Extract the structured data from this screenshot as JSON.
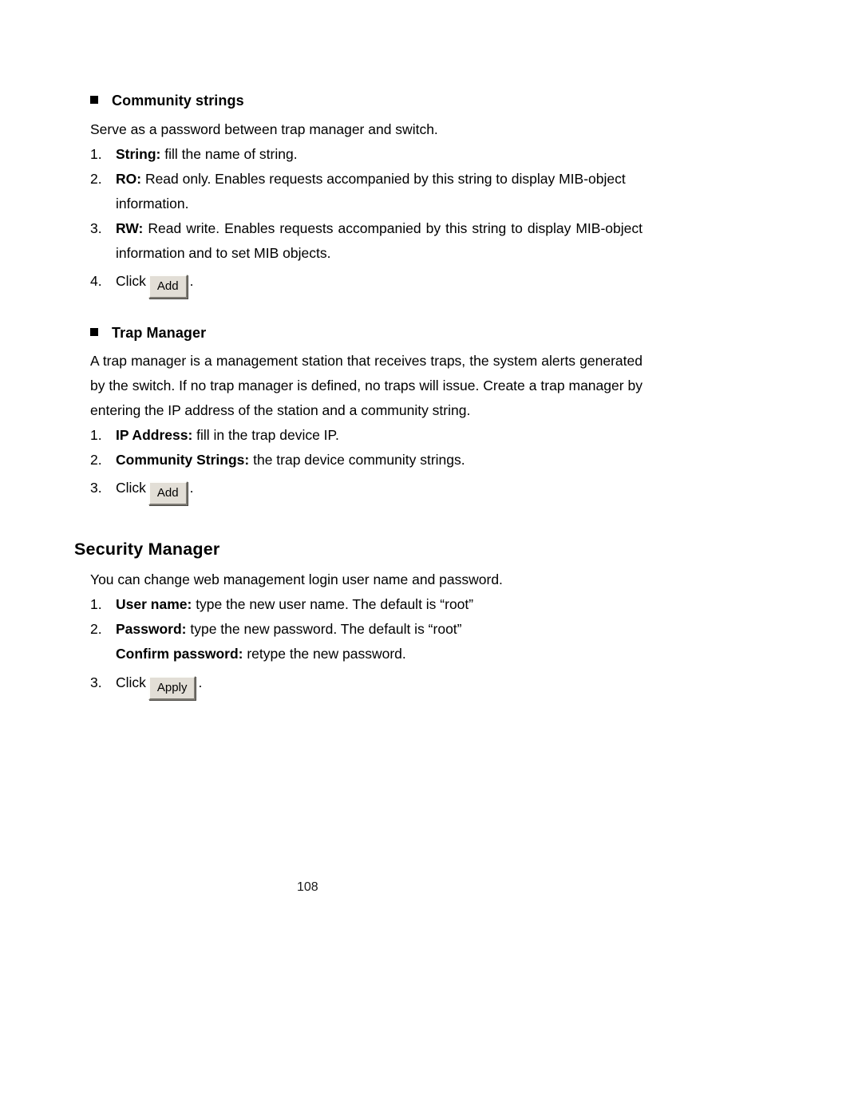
{
  "page": {
    "number": "108",
    "background": "#ffffff",
    "text_color": "#000000"
  },
  "sections": [
    {
      "id": "community-strings",
      "heading": "Community strings",
      "bullet": "filled-square",
      "intro": "Serve as a password between trap manager and switch.",
      "items": [
        {
          "num": "1.",
          "label": "String:",
          "text": " fill the name of string.",
          "type": "text"
        },
        {
          "num": "2.",
          "label": "RO:",
          "text": " Read only. Enables requests accompanied by this string to display MIB-object information.",
          "type": "text"
        },
        {
          "num": "3.",
          "label": "RW:",
          "text": " Read write. Enables requests accompanied by this string to display MIB-object information and to set MIB objects.",
          "type": "text"
        },
        {
          "num": "4.",
          "label": "",
          "text": "Click",
          "type": "button",
          "button_label": "Add",
          "suffix": "."
        }
      ]
    },
    {
      "id": "trap-manager",
      "heading": "Trap Manager",
      "bullet": "filled-square",
      "paragraph": "A trap manager is a management station that receives traps, the system alerts generated by the switch. If no trap manager is defined, no traps will issue. Create a trap manager by entering the IP address of the station and a community string.",
      "items": [
        {
          "num": "1.",
          "label": "IP Address:",
          "text": " fill in the trap device IP.",
          "type": "text"
        },
        {
          "num": "2.",
          "label": "Community Strings:",
          "text": " the trap device community strings.",
          "type": "text"
        },
        {
          "num": "3.",
          "label": "",
          "text": "Click",
          "type": "button",
          "button_label": "Add",
          "suffix": "."
        }
      ]
    }
  ],
  "security_manager": {
    "heading": "Security Manager",
    "intro": "You can change web management login user name and password.",
    "items": [
      {
        "num": "1.",
        "label": "User name:",
        "text": " type the new user name. The default is “root”",
        "type": "text"
      },
      {
        "num": "2.",
        "label": "Password:",
        "text": " type the new password. The default is “root”",
        "type": "text"
      },
      {
        "num": "",
        "label": "Confirm password:",
        "text": " retype the new password.",
        "type": "text-continuation"
      },
      {
        "num": "3.",
        "label": "",
        "text": "Click",
        "type": "button",
        "button_label": "Apply",
        "suffix": "."
      }
    ]
  }
}
